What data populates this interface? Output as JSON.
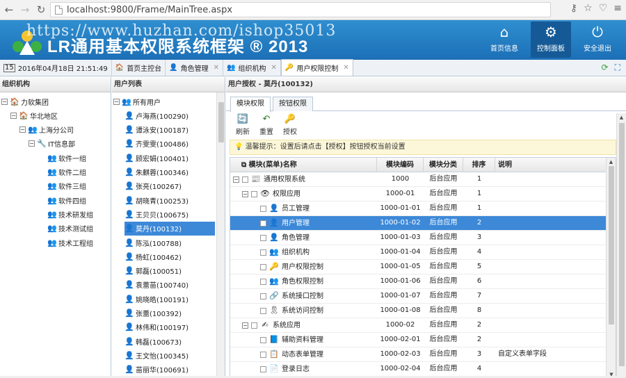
{
  "browser": {
    "url": "localhost:9800/Frame/MainTree.aspx"
  },
  "header": {
    "watermark": "https://www.huzhan.com/ishop35013",
    "title": "LR通用基本权限系统框架 ® 2013",
    "buttons": [
      {
        "label": "首页信息",
        "icon": "home-icon"
      },
      {
        "label": "控制面板",
        "icon": "gears-icon"
      },
      {
        "label": "安全退出",
        "icon": "power-icon"
      }
    ]
  },
  "tabs": {
    "datetime": "2016年04月18日 21:51:49",
    "items": [
      {
        "label": "首页主控台",
        "icon": "🏠"
      },
      {
        "label": "角色管理",
        "icon": "👤",
        "close": "✕"
      },
      {
        "label": "组织机构",
        "icon": "👥",
        "close": "✕"
      },
      {
        "label": "用户权限控制",
        "icon": "🔑",
        "close": "✕"
      }
    ]
  },
  "org": {
    "title": "组织机构",
    "nodes": [
      {
        "label": "力软集团",
        "icon": "🏠",
        "exp": "−"
      },
      {
        "label": "华北地区",
        "icon": "🏠",
        "exp": "−"
      },
      {
        "label": "上海分公司",
        "icon": "👥",
        "exp": "−"
      },
      {
        "label": "IT信息部",
        "icon": "🔧",
        "exp": "−"
      },
      {
        "label": "软件一组",
        "icon": "👥"
      },
      {
        "label": "软件二组",
        "icon": "👥"
      },
      {
        "label": "软件三组",
        "icon": "👥"
      },
      {
        "label": "软件四组",
        "icon": "👥"
      },
      {
        "label": "技术研发组",
        "icon": "👥"
      },
      {
        "label": "技术测试组",
        "icon": "👥"
      },
      {
        "label": "技术工程组",
        "icon": "👥"
      }
    ]
  },
  "users": {
    "title": "用户列表",
    "root": "所有用户",
    "items": [
      "卢海燕(100290)",
      "谭泳安(100187)",
      "齐雯雯(100486)",
      "顾宏娟(100401)",
      "朱麒蓉(100346)",
      "张亮(100267)",
      "胡晓青(100253)",
      "王贝贝(100675)",
      "莫丹(100132)",
      "陈泓(100788)",
      "杨虹(100462)",
      "郭磊(100051)",
      "袁蕾苗(100740)",
      "姚晓皓(100191)",
      "张蕾(100392)",
      "林伟和(100197)",
      "韩磊(100673)",
      "王文怡(100345)",
      "苗丽华(100691)"
    ],
    "selected": 8
  },
  "main": {
    "title": "用户授权 - 莫丹(100132)",
    "subtabs": [
      "模块权限",
      "按钮权限"
    ],
    "toolbar": [
      {
        "label": "刷新",
        "icon": "🔄"
      },
      {
        "label": "重置",
        "icon": "↶"
      },
      {
        "label": "授权",
        "icon": "🔑"
      }
    ],
    "tip": "温馨提示：设置后请点击【授权】按钮授权当前设置",
    "columns": [
      "模块(菜单)名称",
      "模块编码",
      "模块分类",
      "排序",
      "说明"
    ],
    "rows": [
      {
        "name": "通用权限系统",
        "code": "1000",
        "cat": "后台应用",
        "sort": "1",
        "desc": "",
        "level": 0,
        "exp": "−",
        "icon": "📰"
      },
      {
        "name": "权限应用",
        "code": "1000-01",
        "cat": "后台应用",
        "sort": "1",
        "desc": "",
        "level": 1,
        "exp": "−",
        "icon": "👁"
      },
      {
        "name": "员工管理",
        "code": "1000-01-01",
        "cat": "后台应用",
        "sort": "1",
        "desc": "",
        "level": 2,
        "icon": "👤"
      },
      {
        "name": "用户管理",
        "code": "1000-01-02",
        "cat": "后台应用",
        "sort": "2",
        "desc": "",
        "level": 2,
        "icon": "👤"
      },
      {
        "name": "角色管理",
        "code": "1000-01-03",
        "cat": "后台应用",
        "sort": "3",
        "desc": "",
        "level": 2,
        "icon": "👤"
      },
      {
        "name": "组织机构",
        "code": "1000-01-04",
        "cat": "后台应用",
        "sort": "4",
        "desc": "",
        "level": 2,
        "icon": "👥"
      },
      {
        "name": "用户权限控制",
        "code": "1000-01-05",
        "cat": "后台应用",
        "sort": "5",
        "desc": "",
        "level": 2,
        "icon": "🔑"
      },
      {
        "name": "角色权限控制",
        "code": "1000-01-06",
        "cat": "后台应用",
        "sort": "6",
        "desc": "",
        "level": 2,
        "icon": "👥"
      },
      {
        "name": "系统接口控制",
        "code": "1000-01-07",
        "cat": "后台应用",
        "sort": "7",
        "desc": "",
        "level": 2,
        "icon": "🔗"
      },
      {
        "name": "系统访问控制",
        "code": "1000-01-08",
        "cat": "后台应用",
        "sort": "8",
        "desc": "",
        "level": 2,
        "icon": "🎗"
      },
      {
        "name": "系统应用",
        "code": "1000-02",
        "cat": "后台应用",
        "sort": "2",
        "desc": "",
        "level": 1,
        "exp": "−",
        "icon": "✍"
      },
      {
        "name": "辅助资料管理",
        "code": "1000-02-01",
        "cat": "后台应用",
        "sort": "2",
        "desc": "",
        "level": 2,
        "icon": "📘"
      },
      {
        "name": "动态表单管理",
        "code": "1000-02-03",
        "cat": "后台应用",
        "sort": "3",
        "desc": "自定义表单字段",
        "level": 2,
        "icon": "📋"
      },
      {
        "name": "登录日志",
        "code": "1000-02-04",
        "cat": "后台应用",
        "sort": "4",
        "desc": "",
        "level": 2,
        "icon": "📄"
      }
    ],
    "selected_row": 3
  },
  "colors": {
    "header": "#1c6fb6",
    "selection": "#3d89d8",
    "tip_bg": "#fdf7d9"
  }
}
